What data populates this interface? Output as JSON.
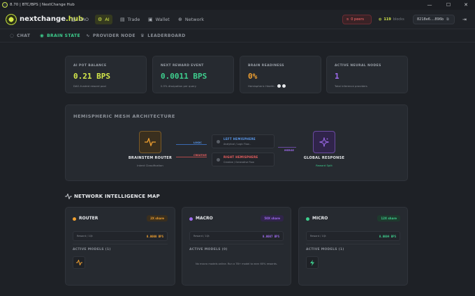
{
  "titlebar": {
    "title": "8.70 | BTC/BPS | NextChange Hub",
    "minimize": "—",
    "maximize": "☐",
    "close": "✕"
  },
  "brand": {
    "name": "nextchange",
    "suffix": ".hub"
  },
  "nav": {
    "items": [
      {
        "label": "DAO",
        "icon": "▥"
      },
      {
        "label": "AI",
        "icon": "⚙"
      },
      {
        "label": "Trade",
        "icon": "▤"
      },
      {
        "label": "Wallet",
        "icon": "▣"
      },
      {
        "label": "Network",
        "icon": "⊕"
      }
    ]
  },
  "status": {
    "peers": "0 peers",
    "blocks_count": "119",
    "blocks_label": "blocks",
    "address": "8218e6....896b"
  },
  "subnav": {
    "items": [
      {
        "label": "CHAT",
        "icon": "◌"
      },
      {
        "label": "BRAIN STATE",
        "icon": "◉"
      },
      {
        "label": "PROVIDER NODE",
        "icon": "∿"
      },
      {
        "label": "LEADERBOARD",
        "icon": "♛"
      }
    ]
  },
  "stats": [
    {
      "label": "AI POT BALANCE",
      "value": "0.21 BPS",
      "sub": "DAO-funded reward pool",
      "color": "#d4e84a"
    },
    {
      "label": "NEXT REWARD EVENT",
      "value": "0.0011 BPS",
      "sub": "0.5% dissipation per query",
      "color": "#3ecf8e"
    },
    {
      "label": "BRAIN READINESS",
      "value": "0%",
      "sub": "Hemispheric Health:",
      "color": "#f0a030"
    },
    {
      "label": "ACTIVE NEURAL NODES",
      "value": "1",
      "sub": "Total inference providers",
      "color": "#a06cf0"
    }
  ],
  "mesh": {
    "title": "HEMISPHERIC MESH ARCHITECTURE",
    "router": {
      "title": "BRAINSTEM ROUTER",
      "sub": "Intent Classification"
    },
    "line_labels": {
      "logic": "LOGIC",
      "creative": "CREATIVE",
      "merge": "MERGE"
    },
    "left": {
      "title": "LEFT HEMISPHERE",
      "sub": "Analytical / Logic Flow..."
    },
    "right": {
      "title": "RIGHT HEMISPHERE",
      "sub": "Creative / Generative Flow"
    },
    "global": {
      "title": "GLOBAL RESPONSE",
      "sub": "Reward Split"
    }
  },
  "map": {
    "title": "NETWORK INTELLIGENCE MAP",
    "cards": [
      {
        "title": "ROUTER",
        "badge": "2X share",
        "color": "#f0a030",
        "reward_label": "Reward / 1Qt",
        "reward": "0.0000 BPS",
        "active": "ACTIVE MODELS (1)",
        "empty": ""
      },
      {
        "title": "MACRO",
        "badge": "50X share",
        "color": "#a06cf0",
        "reward_label": "Reward / 1Qt",
        "reward": "0.0007 BPS",
        "active": "ACTIVE MODELS (0)",
        "empty": "No macro models online. Run a 7B+ model to earn 60% rewards."
      },
      {
        "title": "MICRO",
        "badge": "12X share",
        "color": "#3ecf8e",
        "reward_label": "Reward / 1Qt",
        "reward": "0.0004 BPS",
        "active": "ACTIVE MODELS (1)",
        "empty": ""
      }
    ]
  }
}
